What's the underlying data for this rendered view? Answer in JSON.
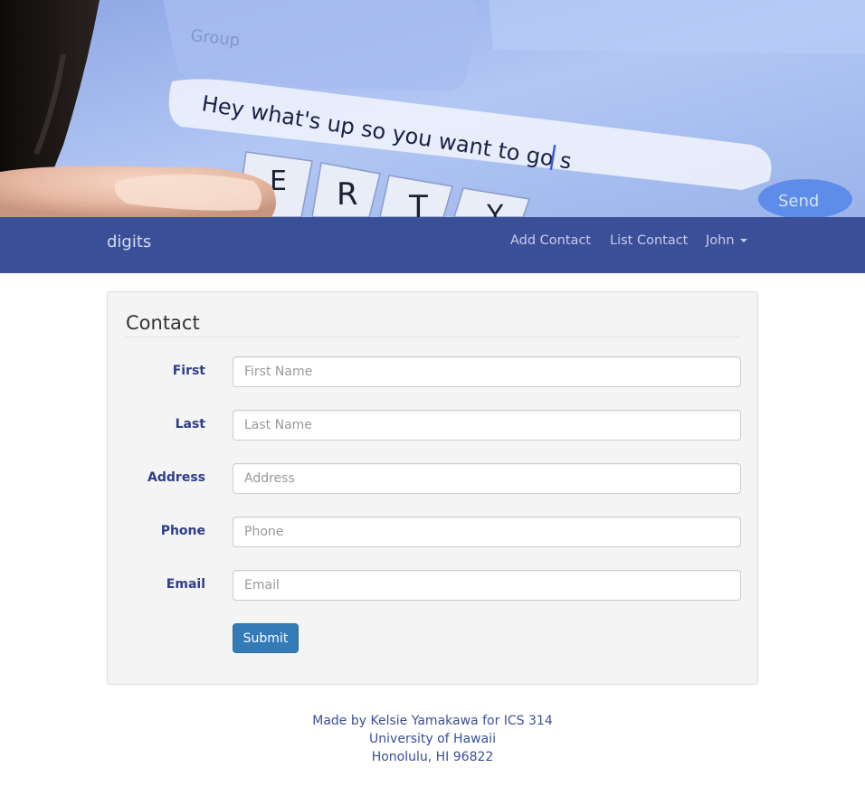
{
  "navbar": {
    "brand": "digits",
    "links": {
      "add_contact": "Add Contact",
      "list_contact": "List Contact",
      "user": "John"
    }
  },
  "hero": {
    "screen_text": "Hey what's up so you want to go s",
    "keys": [
      "E",
      "R",
      "T",
      "Y"
    ],
    "send_label": "Send"
  },
  "form": {
    "title": "Contact",
    "fields": {
      "first": {
        "label": "First",
        "placeholder": "First Name"
      },
      "last": {
        "label": "Last",
        "placeholder": "Last Name"
      },
      "address": {
        "label": "Address",
        "placeholder": "Address"
      },
      "phone": {
        "label": "Phone",
        "placeholder": "Phone"
      },
      "email": {
        "label": "Email",
        "placeholder": "Email"
      }
    },
    "submit_label": "Submit"
  },
  "footer": {
    "line1": "Made by Kelsie Yamakawa for ICS 314",
    "line2": "University of Hawaii",
    "line3": "Honolulu, HI 96822"
  },
  "colors": {
    "navbar_bg": "#3a4f98",
    "label_text": "#2e3d8a",
    "submit_bg": "#337ab7",
    "panel_bg": "#f4f4f4"
  }
}
